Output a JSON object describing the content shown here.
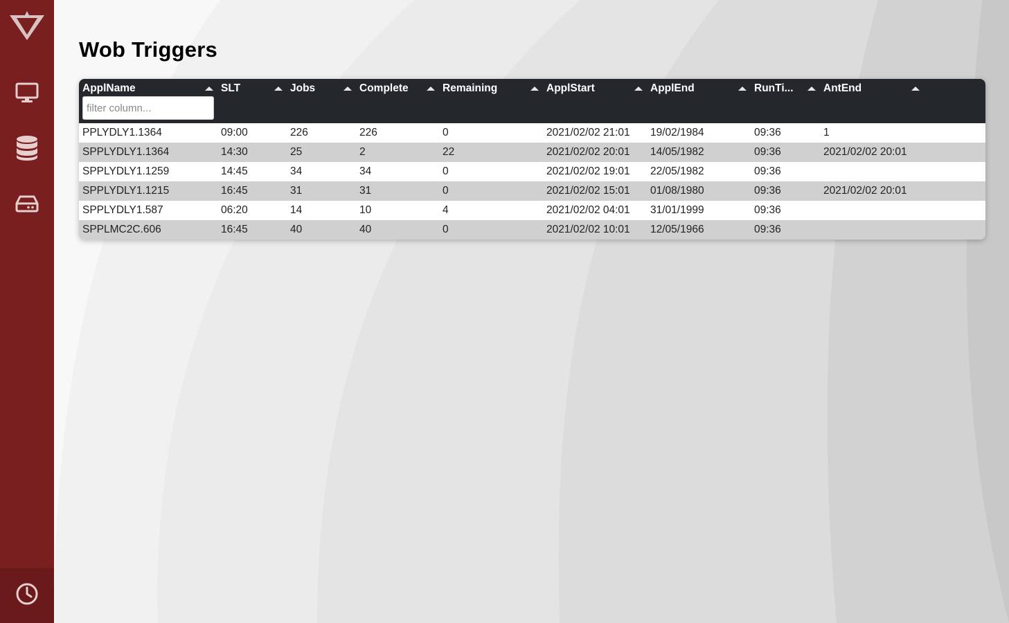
{
  "page": {
    "title": "Wob Triggers"
  },
  "sidebar": {
    "items": [
      {
        "icon": "monitor-icon"
      },
      {
        "icon": "database-icon"
      },
      {
        "icon": "hard-drive-icon"
      }
    ],
    "bottom": {
      "icon": "clock-icon"
    }
  },
  "table": {
    "columns": [
      "ApplName",
      "SLT",
      "Jobs",
      "Complete",
      "Remaining",
      "ApplStart",
      "ApplEnd",
      "RunTi...",
      "AntEnd"
    ],
    "filter_placeholder": "filter column...",
    "rows": [
      [
        "PPLYDLY1.1364",
        "09:00",
        "226",
        "226",
        "0",
        "2021/02/02 21:01",
        "19/02/1984",
        "09:36",
        "1"
      ],
      [
        "SPPLYDLY1.1364",
        "14:30",
        "25",
        "2",
        "22",
        "2021/02/02 20:01",
        "14/05/1982",
        "09:36",
        "2021/02/02 20:01"
      ],
      [
        "SPPLYDLY1.1259",
        "14:45",
        "34",
        "34",
        "0",
        "2021/02/02 19:01",
        "22/05/1982",
        "09:36",
        ""
      ],
      [
        "SPPLYDLY1.1215",
        "16:45",
        "31",
        "31",
        "0",
        "2021/02/02 15:01",
        "01/08/1980",
        "09:36",
        "2021/02/02 20:01"
      ],
      [
        "SPPLYDLY1.587",
        "06:20",
        "14",
        "10",
        "4",
        "2021/02/02 04:01",
        "31/01/1999",
        "09:36",
        ""
      ],
      [
        "SPPLMC2C.606",
        "16:45",
        "40",
        "40",
        "0",
        "2021/02/02 10:01",
        "12/05/1966",
        "09:36",
        ""
      ]
    ]
  },
  "colors": {
    "sidebar": "#7a1f1f",
    "header": "#24282c",
    "row_alt": "#d0d0d0"
  }
}
